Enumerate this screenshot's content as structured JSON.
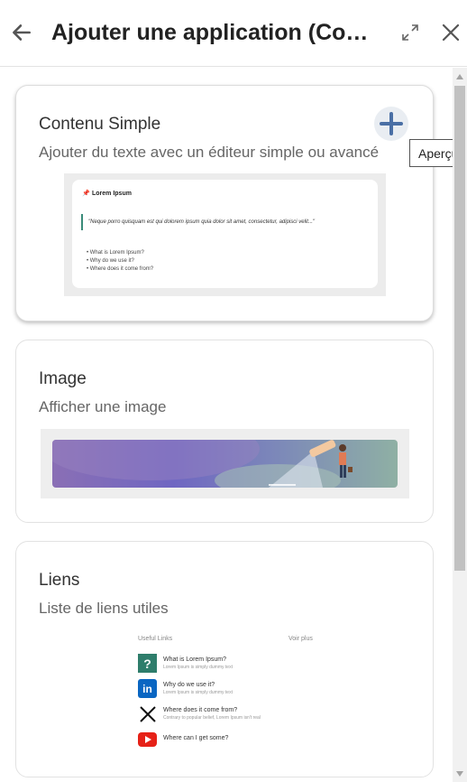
{
  "header": {
    "title": "Ajouter une application (Contenu)",
    "back_icon": "arrow-left-icon",
    "expand_icon": "expand-icon",
    "close_icon": "close-icon"
  },
  "tooltip": {
    "text": "Aperçu"
  },
  "cards": [
    {
      "title": "Contenu Simple",
      "description": "Ajouter du texte avec un éditeur simple ou avancé",
      "add_icon": "plus-icon",
      "preview": {
        "title": "Lorem Ipsum",
        "quote": "\"Neque porro quisquam est qui dolorem ipsum quia dolor sit amet, consectetur, adipisci velit...\"",
        "bullets": [
          "• What is Lorem Ipsum?",
          "• Why do we use it?",
          "• Where does it come from?"
        ]
      }
    },
    {
      "title": "Image",
      "description": "Afficher une image"
    },
    {
      "title": "Liens",
      "description": "Liste de liens utiles",
      "preview": {
        "heading": "Useful Links",
        "more": "Voir plus",
        "links": [
          {
            "icon": "question-icon",
            "title": "What is Lorem Ipsum?",
            "subtitle": "Lorem Ipsum is simply dummy text"
          },
          {
            "icon": "linkedin-icon",
            "title": "Why do we use it?",
            "subtitle": "Lorem Ipsum is simply dummy text"
          },
          {
            "icon": "x-logo-icon",
            "title": "Where does it come from?",
            "subtitle": "Contrary to popular belief, Lorem Ipsum isn't real"
          },
          {
            "icon": "youtube-icon",
            "title": "Where can I get some?",
            "subtitle": ""
          }
        ]
      }
    }
  ],
  "colors": {
    "accent": "#4a6fa5",
    "border": "#e2e2e2",
    "scroll_thumb": "#c1c1c1"
  }
}
